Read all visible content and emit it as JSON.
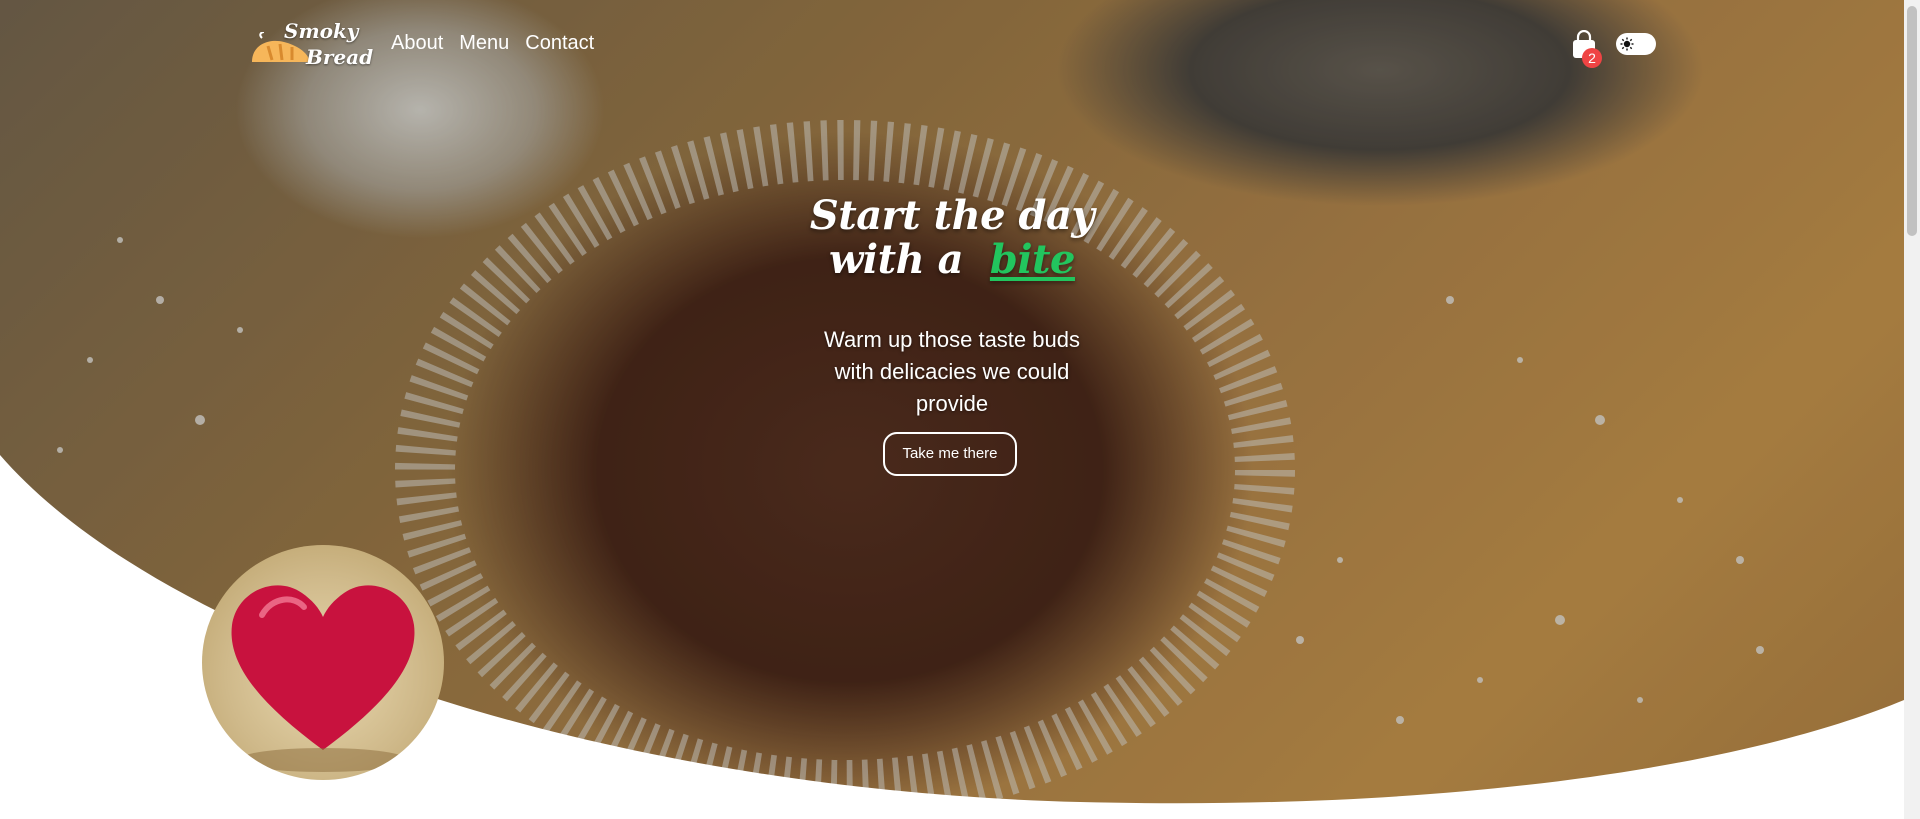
{
  "brand": {
    "line1": "Smoky",
    "line2": "Bread"
  },
  "nav": {
    "items": [
      "About",
      "Menu",
      "Contact"
    ]
  },
  "cart": {
    "count": "2"
  },
  "hero": {
    "title_line1": "Start the day",
    "title_line2_prefix": "with a",
    "title_accent": "bite",
    "subtitle": "Warm up those taste buds with delicacies we could provide",
    "cta_label": "Take me there"
  },
  "colors": {
    "accent": "#22c55e",
    "badge": "#ef4444",
    "cta_border": "#ffffff"
  },
  "icons": {
    "cart": "shopping-bag-icon",
    "theme": "sun-icon",
    "logo": "bread-icon"
  }
}
